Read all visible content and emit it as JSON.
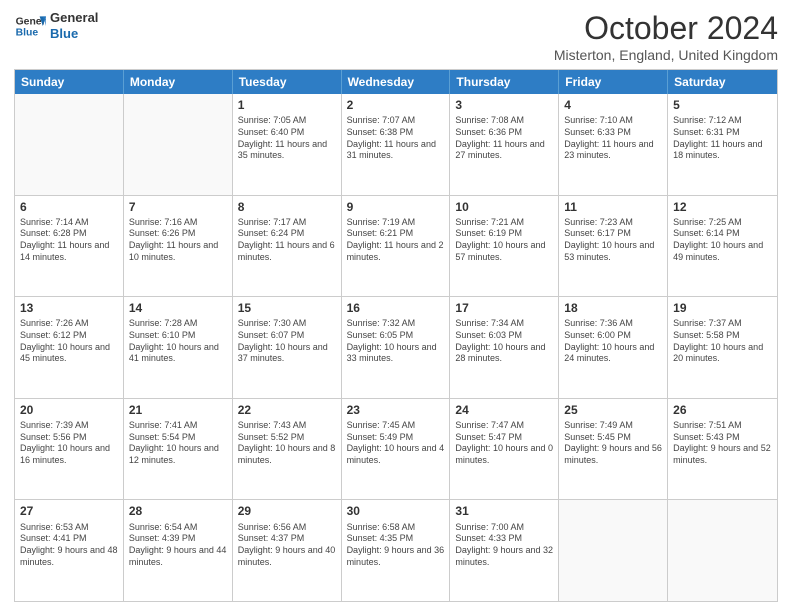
{
  "header": {
    "logo_line1": "General",
    "logo_line2": "Blue",
    "month_title": "October 2024",
    "location": "Misterton, England, United Kingdom"
  },
  "days_of_week": [
    "Sunday",
    "Monday",
    "Tuesday",
    "Wednesday",
    "Thursday",
    "Friday",
    "Saturday"
  ],
  "weeks": [
    [
      {
        "day": "",
        "sunrise": "",
        "sunset": "",
        "daylight": "",
        "empty": true
      },
      {
        "day": "",
        "sunrise": "",
        "sunset": "",
        "daylight": "",
        "empty": true
      },
      {
        "day": "1",
        "sunrise": "Sunrise: 7:05 AM",
        "sunset": "Sunset: 6:40 PM",
        "daylight": "Daylight: 11 hours and 35 minutes.",
        "empty": false
      },
      {
        "day": "2",
        "sunrise": "Sunrise: 7:07 AM",
        "sunset": "Sunset: 6:38 PM",
        "daylight": "Daylight: 11 hours and 31 minutes.",
        "empty": false
      },
      {
        "day": "3",
        "sunrise": "Sunrise: 7:08 AM",
        "sunset": "Sunset: 6:36 PM",
        "daylight": "Daylight: 11 hours and 27 minutes.",
        "empty": false
      },
      {
        "day": "4",
        "sunrise": "Sunrise: 7:10 AM",
        "sunset": "Sunset: 6:33 PM",
        "daylight": "Daylight: 11 hours and 23 minutes.",
        "empty": false
      },
      {
        "day": "5",
        "sunrise": "Sunrise: 7:12 AM",
        "sunset": "Sunset: 6:31 PM",
        "daylight": "Daylight: 11 hours and 18 minutes.",
        "empty": false
      }
    ],
    [
      {
        "day": "6",
        "sunrise": "Sunrise: 7:14 AM",
        "sunset": "Sunset: 6:28 PM",
        "daylight": "Daylight: 11 hours and 14 minutes.",
        "empty": false
      },
      {
        "day": "7",
        "sunrise": "Sunrise: 7:16 AM",
        "sunset": "Sunset: 6:26 PM",
        "daylight": "Daylight: 11 hours and 10 minutes.",
        "empty": false
      },
      {
        "day": "8",
        "sunrise": "Sunrise: 7:17 AM",
        "sunset": "Sunset: 6:24 PM",
        "daylight": "Daylight: 11 hours and 6 minutes.",
        "empty": false
      },
      {
        "day": "9",
        "sunrise": "Sunrise: 7:19 AM",
        "sunset": "Sunset: 6:21 PM",
        "daylight": "Daylight: 11 hours and 2 minutes.",
        "empty": false
      },
      {
        "day": "10",
        "sunrise": "Sunrise: 7:21 AM",
        "sunset": "Sunset: 6:19 PM",
        "daylight": "Daylight: 10 hours and 57 minutes.",
        "empty": false
      },
      {
        "day": "11",
        "sunrise": "Sunrise: 7:23 AM",
        "sunset": "Sunset: 6:17 PM",
        "daylight": "Daylight: 10 hours and 53 minutes.",
        "empty": false
      },
      {
        "day": "12",
        "sunrise": "Sunrise: 7:25 AM",
        "sunset": "Sunset: 6:14 PM",
        "daylight": "Daylight: 10 hours and 49 minutes.",
        "empty": false
      }
    ],
    [
      {
        "day": "13",
        "sunrise": "Sunrise: 7:26 AM",
        "sunset": "Sunset: 6:12 PM",
        "daylight": "Daylight: 10 hours and 45 minutes.",
        "empty": false
      },
      {
        "day": "14",
        "sunrise": "Sunrise: 7:28 AM",
        "sunset": "Sunset: 6:10 PM",
        "daylight": "Daylight: 10 hours and 41 minutes.",
        "empty": false
      },
      {
        "day": "15",
        "sunrise": "Sunrise: 7:30 AM",
        "sunset": "Sunset: 6:07 PM",
        "daylight": "Daylight: 10 hours and 37 minutes.",
        "empty": false
      },
      {
        "day": "16",
        "sunrise": "Sunrise: 7:32 AM",
        "sunset": "Sunset: 6:05 PM",
        "daylight": "Daylight: 10 hours and 33 minutes.",
        "empty": false
      },
      {
        "day": "17",
        "sunrise": "Sunrise: 7:34 AM",
        "sunset": "Sunset: 6:03 PM",
        "daylight": "Daylight: 10 hours and 28 minutes.",
        "empty": false
      },
      {
        "day": "18",
        "sunrise": "Sunrise: 7:36 AM",
        "sunset": "Sunset: 6:00 PM",
        "daylight": "Daylight: 10 hours and 24 minutes.",
        "empty": false
      },
      {
        "day": "19",
        "sunrise": "Sunrise: 7:37 AM",
        "sunset": "Sunset: 5:58 PM",
        "daylight": "Daylight: 10 hours and 20 minutes.",
        "empty": false
      }
    ],
    [
      {
        "day": "20",
        "sunrise": "Sunrise: 7:39 AM",
        "sunset": "Sunset: 5:56 PM",
        "daylight": "Daylight: 10 hours and 16 minutes.",
        "empty": false
      },
      {
        "day": "21",
        "sunrise": "Sunrise: 7:41 AM",
        "sunset": "Sunset: 5:54 PM",
        "daylight": "Daylight: 10 hours and 12 minutes.",
        "empty": false
      },
      {
        "day": "22",
        "sunrise": "Sunrise: 7:43 AM",
        "sunset": "Sunset: 5:52 PM",
        "daylight": "Daylight: 10 hours and 8 minutes.",
        "empty": false
      },
      {
        "day": "23",
        "sunrise": "Sunrise: 7:45 AM",
        "sunset": "Sunset: 5:49 PM",
        "daylight": "Daylight: 10 hours and 4 minutes.",
        "empty": false
      },
      {
        "day": "24",
        "sunrise": "Sunrise: 7:47 AM",
        "sunset": "Sunset: 5:47 PM",
        "daylight": "Daylight: 10 hours and 0 minutes.",
        "empty": false
      },
      {
        "day": "25",
        "sunrise": "Sunrise: 7:49 AM",
        "sunset": "Sunset: 5:45 PM",
        "daylight": "Daylight: 9 hours and 56 minutes.",
        "empty": false
      },
      {
        "day": "26",
        "sunrise": "Sunrise: 7:51 AM",
        "sunset": "Sunset: 5:43 PM",
        "daylight": "Daylight: 9 hours and 52 minutes.",
        "empty": false
      }
    ],
    [
      {
        "day": "27",
        "sunrise": "Sunrise: 6:53 AM",
        "sunset": "Sunset: 4:41 PM",
        "daylight": "Daylight: 9 hours and 48 minutes.",
        "empty": false
      },
      {
        "day": "28",
        "sunrise": "Sunrise: 6:54 AM",
        "sunset": "Sunset: 4:39 PM",
        "daylight": "Daylight: 9 hours and 44 minutes.",
        "empty": false
      },
      {
        "day": "29",
        "sunrise": "Sunrise: 6:56 AM",
        "sunset": "Sunset: 4:37 PM",
        "daylight": "Daylight: 9 hours and 40 minutes.",
        "empty": false
      },
      {
        "day": "30",
        "sunrise": "Sunrise: 6:58 AM",
        "sunset": "Sunset: 4:35 PM",
        "daylight": "Daylight: 9 hours and 36 minutes.",
        "empty": false
      },
      {
        "day": "31",
        "sunrise": "Sunrise: 7:00 AM",
        "sunset": "Sunset: 4:33 PM",
        "daylight": "Daylight: 9 hours and 32 minutes.",
        "empty": false
      },
      {
        "day": "",
        "sunrise": "",
        "sunset": "",
        "daylight": "",
        "empty": true
      },
      {
        "day": "",
        "sunrise": "",
        "sunset": "",
        "daylight": "",
        "empty": true
      }
    ]
  ]
}
